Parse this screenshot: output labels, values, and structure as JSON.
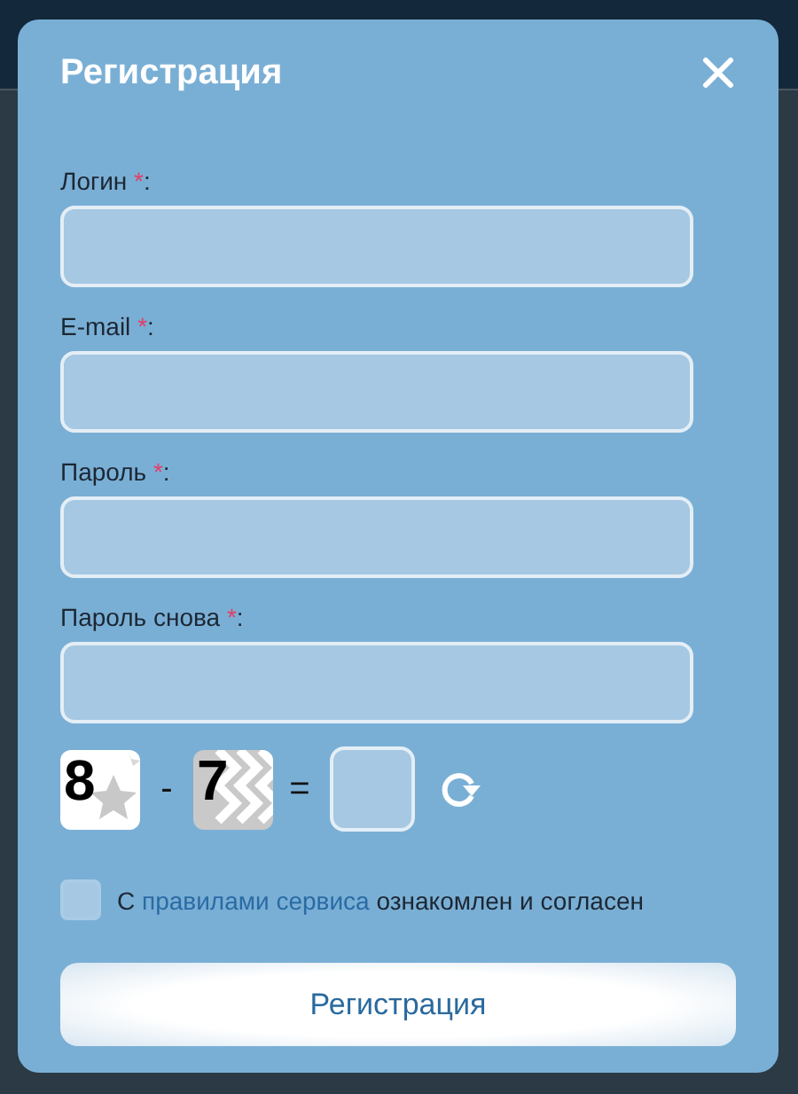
{
  "dialog": {
    "title": "Регистрация"
  },
  "fields": [
    {
      "label": "Логин",
      "star": "*",
      "tail": ":"
    },
    {
      "label": "E-mail",
      "star": "*",
      "tail": ":"
    },
    {
      "label": "Пароль",
      "star": "*",
      "tail": ":"
    },
    {
      "label": "Пароль снова",
      "star": "*",
      "tail": ":"
    }
  ],
  "captcha": {
    "first": "8",
    "operator": "-",
    "second": "7",
    "equals": "="
  },
  "agreement": {
    "checked": false,
    "before": "С",
    "link": "правилами сервиса",
    "after": "ознакомлен и согласен"
  },
  "submit": {
    "label": "Регистрация"
  }
}
